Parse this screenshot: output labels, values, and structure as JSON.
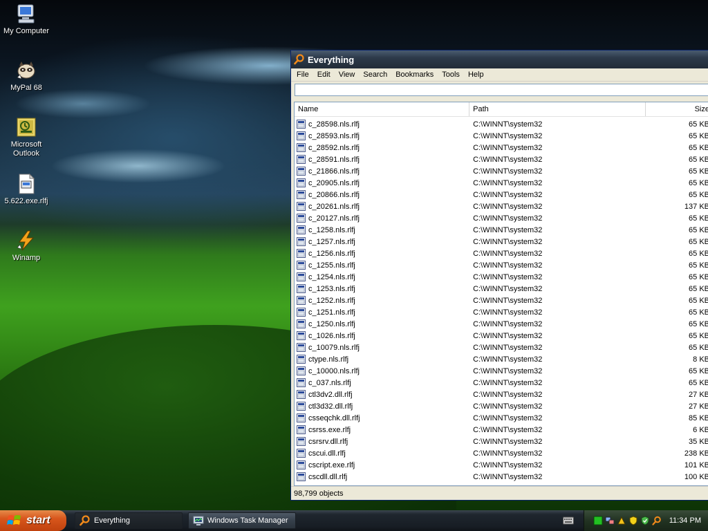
{
  "desktop": {
    "icons": [
      {
        "label": "My Computer"
      },
      {
        "label": "MyPal 68"
      },
      {
        "label": "Microsoft Outlook"
      },
      {
        "label": "5.622.exe.rlfj"
      },
      {
        "label": "Winamp"
      }
    ]
  },
  "window": {
    "title": "Everything",
    "menu": [
      "File",
      "Edit",
      "View",
      "Search",
      "Bookmarks",
      "Tools",
      "Help"
    ],
    "search": {
      "value": "",
      "placeholder": ""
    },
    "columns": {
      "name": "Name",
      "path": "Path",
      "size": "Size"
    },
    "rows": [
      {
        "name": "c_28598.nls.rlfj",
        "path": "C:\\WINNT\\system32",
        "size": "65 KB"
      },
      {
        "name": "c_28593.nls.rlfj",
        "path": "C:\\WINNT\\system32",
        "size": "65 KB"
      },
      {
        "name": "c_28592.nls.rlfj",
        "path": "C:\\WINNT\\system32",
        "size": "65 KB"
      },
      {
        "name": "c_28591.nls.rlfj",
        "path": "C:\\WINNT\\system32",
        "size": "65 KB"
      },
      {
        "name": "c_21866.nls.rlfj",
        "path": "C:\\WINNT\\system32",
        "size": "65 KB"
      },
      {
        "name": "c_20905.nls.rlfj",
        "path": "C:\\WINNT\\system32",
        "size": "65 KB"
      },
      {
        "name": "c_20866.nls.rlfj",
        "path": "C:\\WINNT\\system32",
        "size": "65 KB"
      },
      {
        "name": "c_20261.nls.rlfj",
        "path": "C:\\WINNT\\system32",
        "size": "137 KB"
      },
      {
        "name": "c_20127.nls.rlfj",
        "path": "C:\\WINNT\\system32",
        "size": "65 KB"
      },
      {
        "name": "c_1258.nls.rlfj",
        "path": "C:\\WINNT\\system32",
        "size": "65 KB"
      },
      {
        "name": "c_1257.nls.rlfj",
        "path": "C:\\WINNT\\system32",
        "size": "65 KB"
      },
      {
        "name": "c_1256.nls.rlfj",
        "path": "C:\\WINNT\\system32",
        "size": "65 KB"
      },
      {
        "name": "c_1255.nls.rlfj",
        "path": "C:\\WINNT\\system32",
        "size": "65 KB"
      },
      {
        "name": "c_1254.nls.rlfj",
        "path": "C:\\WINNT\\system32",
        "size": "65 KB"
      },
      {
        "name": "c_1253.nls.rlfj",
        "path": "C:\\WINNT\\system32",
        "size": "65 KB"
      },
      {
        "name": "c_1252.nls.rlfj",
        "path": "C:\\WINNT\\system32",
        "size": "65 KB"
      },
      {
        "name": "c_1251.nls.rlfj",
        "path": "C:\\WINNT\\system32",
        "size": "65 KB"
      },
      {
        "name": "c_1250.nls.rlfj",
        "path": "C:\\WINNT\\system32",
        "size": "65 KB"
      },
      {
        "name": "c_1026.nls.rlfj",
        "path": "C:\\WINNT\\system32",
        "size": "65 KB"
      },
      {
        "name": "c_10079.nls.rlfj",
        "path": "C:\\WINNT\\system32",
        "size": "65 KB"
      },
      {
        "name": "ctype.nls.rlfj",
        "path": "C:\\WINNT\\system32",
        "size": "8 KB"
      },
      {
        "name": "c_10000.nls.rlfj",
        "path": "C:\\WINNT\\system32",
        "size": "65 KB"
      },
      {
        "name": "c_037.nls.rlfj",
        "path": "C:\\WINNT\\system32",
        "size": "65 KB"
      },
      {
        "name": "ctl3dv2.dll.rlfj",
        "path": "C:\\WINNT\\system32",
        "size": "27 KB"
      },
      {
        "name": "ctl3d32.dll.rlfj",
        "path": "C:\\WINNT\\system32",
        "size": "27 KB"
      },
      {
        "name": "csseqchk.dll.rlfj",
        "path": "C:\\WINNT\\system32",
        "size": "85 KB"
      },
      {
        "name": "csrss.exe.rlfj",
        "path": "C:\\WINNT\\system32",
        "size": "6 KB"
      },
      {
        "name": "csrsrv.dll.rlfj",
        "path": "C:\\WINNT\\system32",
        "size": "35 KB"
      },
      {
        "name": "cscui.dll.rlfj",
        "path": "C:\\WINNT\\system32",
        "size": "238 KB"
      },
      {
        "name": "cscript.exe.rlfj",
        "path": "C:\\WINNT\\system32",
        "size": "101 KB"
      },
      {
        "name": "cscdll.dll.rlfj",
        "path": "C:\\WINNT\\system32",
        "size": "100 KB"
      }
    ],
    "status": "98,799 objects"
  },
  "taskbar": {
    "start_label": "start",
    "tasks": [
      {
        "label": "Everything",
        "active": true
      },
      {
        "label": "Windows Task Manager",
        "active": false
      }
    ],
    "clock": "11:34 PM"
  },
  "colors": {
    "titlebar": "#2d3a4a",
    "start_button": "#d8561c",
    "tray": "#223322"
  }
}
